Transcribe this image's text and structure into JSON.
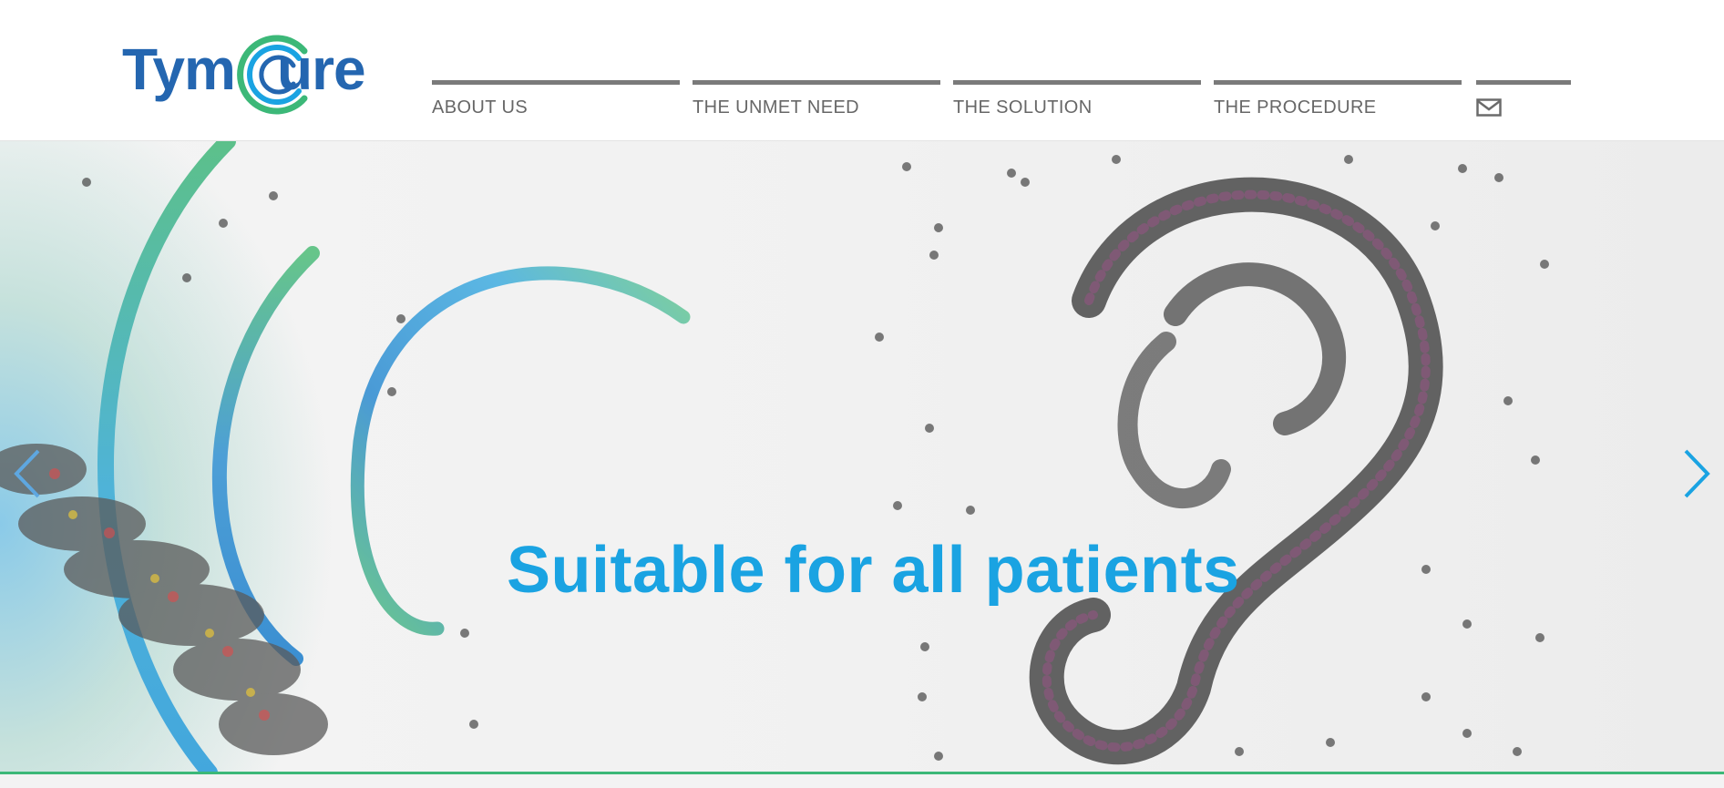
{
  "brand": {
    "name_left": "Tym",
    "name_right": "ure",
    "colors": {
      "blue": "#2466b0",
      "green": "#3cb878",
      "cyan": "#1aa3e2"
    }
  },
  "nav": {
    "items": [
      {
        "label": "ABOUT US"
      },
      {
        "label": "THE UNMET NEED"
      },
      {
        "label": "THE SOLUTION"
      },
      {
        "label": "THE PROCEDURE"
      }
    ],
    "mail_icon": "envelope-icon"
  },
  "hero": {
    "headline": "Suitable for all patients",
    "prev_icon": "chevron-left-icon",
    "next_icon": "chevron-right-icon"
  }
}
